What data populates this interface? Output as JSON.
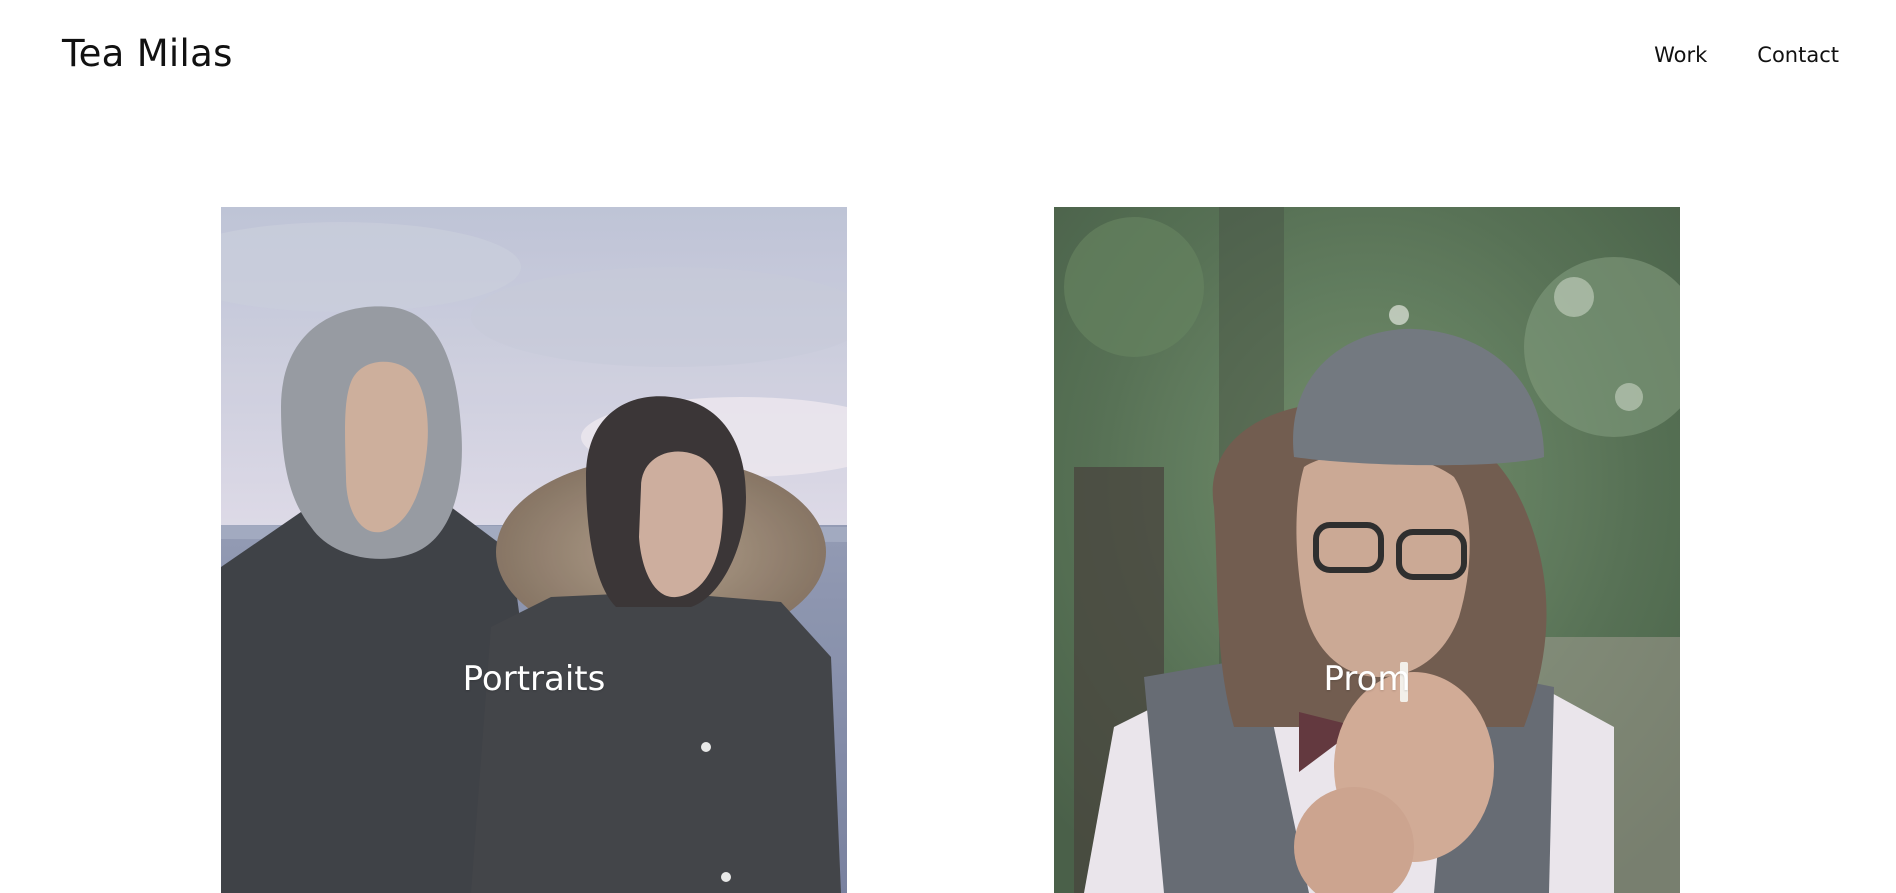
{
  "site": {
    "title": "Tea Milas"
  },
  "nav": {
    "items": [
      {
        "label": "Work"
      },
      {
        "label": "Contact"
      }
    ]
  },
  "gallery": {
    "items": [
      {
        "label": "Portraits",
        "image_subject": "couple-in-winter-jackets-by-the-sea"
      },
      {
        "label": "Prom",
        "image_subject": "young-man-in-flat-cap-lighting-cigarette"
      }
    ]
  },
  "colors": {
    "background": "#ffffff",
    "text": "#111111",
    "overlay_text": "#ffffff"
  }
}
